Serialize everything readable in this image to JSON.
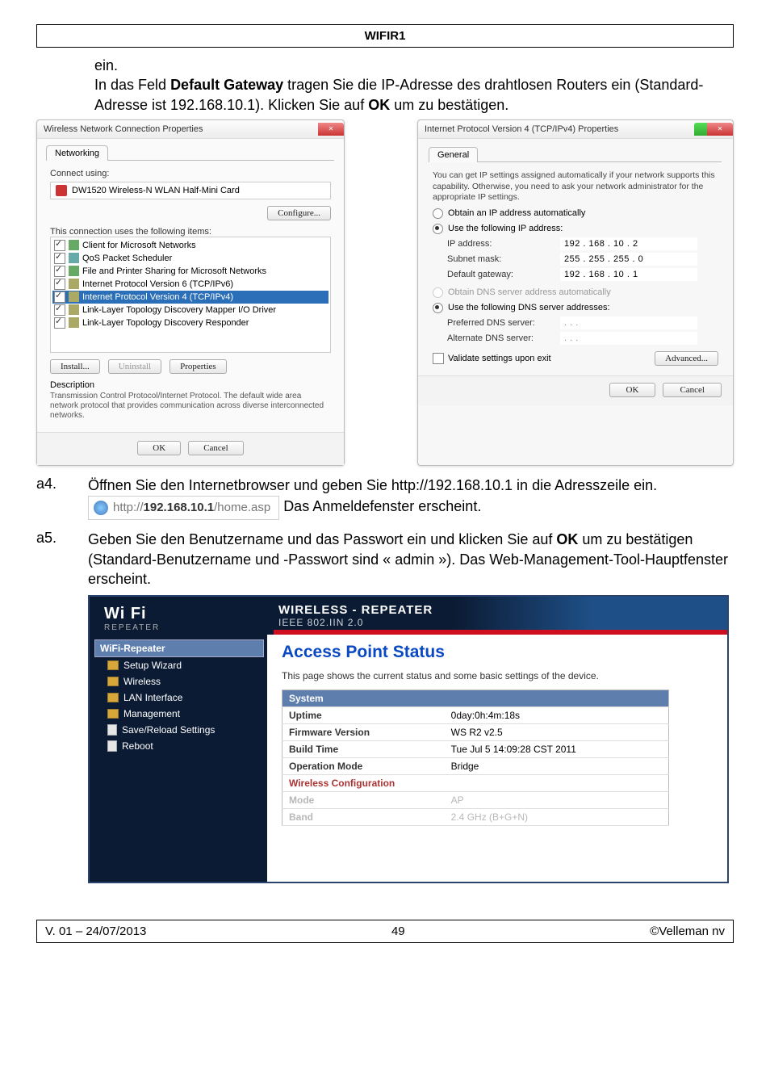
{
  "doc_title": "WIFIR1",
  "intro": {
    "line0": "ein.",
    "line1a": "In das Feld ",
    "line1b": "Default Gateway",
    "line1c": " tragen Sie die IP-Adresse des drahtlosen Routers ein (Standard-Adresse ist 192.168.10.1). Klicken Sie auf ",
    "line1d": "OK",
    "line1e": " um zu bestätigen."
  },
  "dlg1": {
    "title": "Wireless Network Connection Properties",
    "tab": "Networking",
    "connect_using": "Connect using:",
    "adapter": "DW1520 Wireless-N WLAN Half-Mini Card",
    "configure": "Configure...",
    "uses_following": "This connection uses the following items:",
    "items": [
      "Client for Microsoft Networks",
      "QoS Packet Scheduler",
      "File and Printer Sharing for Microsoft Networks",
      "Internet Protocol Version 6 (TCP/IPv6)",
      "Internet Protocol Version 4 (TCP/IPv4)",
      "Link-Layer Topology Discovery Mapper I/O Driver",
      "Link-Layer Topology Discovery Responder"
    ],
    "install": "Install...",
    "uninstall": "Uninstall",
    "properties": "Properties",
    "desc_h": "Description",
    "desc": "Transmission Control Protocol/Internet Protocol. The default wide area network protocol that provides communication across diverse interconnected networks.",
    "ok": "OK",
    "cancel": "Cancel"
  },
  "dlg2": {
    "title": "Internet Protocol Version 4 (TCP/IPv4) Properties",
    "tab": "General",
    "info": "You can get IP settings assigned automatically if your network supports this capability. Otherwise, you need to ask your network administrator for the appropriate IP settings.",
    "r1": "Obtain an IP address automatically",
    "r2": "Use the following IP address:",
    "ip_l": "IP address:",
    "ip_v": "192 . 168 .  10  .   2",
    "sm_l": "Subnet mask:",
    "sm_v": "255 . 255 . 255 .   0",
    "gw_l": "Default gateway:",
    "gw_v": "192 . 168 .  10  .   1",
    "r3": "Obtain DNS server address automatically",
    "r4": "Use the following DNS server addresses:",
    "pd_l": "Preferred DNS server:",
    "pd_v": ".          .          .",
    "ad_l": "Alternate DNS server:",
    "ad_v": ".          .          .",
    "validate": "Validate settings upon exit",
    "advanced": "Advanced...",
    "ok": "OK",
    "cancel": "Cancel"
  },
  "a4": {
    "num": "a4.",
    "text": "Öffnen Sie den Internetbrowser und geben Sie http://192.168.10.1 in die Adresszeile ein.",
    "url_pre": "http://",
    "url_bold": "192.168.10.1",
    "url_post": "/home.asp",
    "after": " Das Anmeldefenster erscheint."
  },
  "a5": {
    "num": "a5.",
    "text1": "Geben Sie den Benutzername und das Passwort ein und klicken Sie auf ",
    "bold": "OK",
    "text2": " um zu bestätigen (Standard-Benutzername und -Passwort sind « admin »). Das Web-Management-Tool-Hauptfenster erscheint."
  },
  "web": {
    "brand": "Wi Fi",
    "brand_sub": "REPEATER",
    "banner_h1": "WIRELESS - REPEATER",
    "banner_h2": "IEEE 802.IIN 2.0",
    "side_top": "WiFi-Repeater",
    "side": [
      "Setup Wizard",
      "Wireless",
      "LAN Interface",
      "Management",
      "Save/Reload Settings",
      "Reboot"
    ],
    "h2": "Access Point Status",
    "sub": "This page shows the current status and some basic settings of the device.",
    "sec1": "System",
    "rows1": [
      {
        "k": "Uptime",
        "v": "0day:0h:4m:18s"
      },
      {
        "k": "Firmware Version",
        "v": "WS R2 v2.5"
      },
      {
        "k": "Build Time",
        "v": "Tue Jul 5 14:09:28 CST 2011"
      },
      {
        "k": "Operation Mode",
        "v": "Bridge"
      }
    ],
    "sec2": "Wireless Configuration",
    "rows2": [
      {
        "k": "Mode",
        "v": "AP"
      },
      {
        "k": "Band",
        "v": "2.4 GHz (B+G+N)"
      }
    ]
  },
  "footer": {
    "left": "V. 01 – 24/07/2013",
    "center": "49",
    "right": "©Velleman nv"
  }
}
